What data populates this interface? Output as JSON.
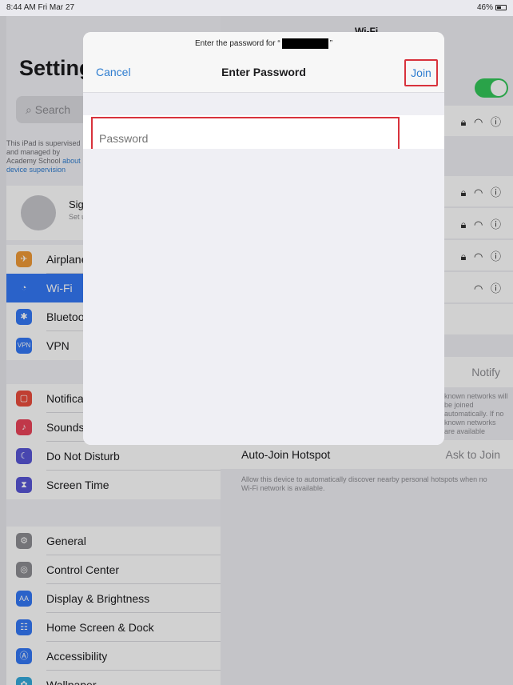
{
  "status": {
    "time": "8:44 AM  Fri Mar 27",
    "battery": "46%"
  },
  "sidebar": {
    "title": "Settings",
    "search_placeholder": "Search",
    "note": "This iPad is supervised and managed by Academy School",
    "note_link": "about device supervision",
    "account_name": "Sign in to your iPad",
    "account_sub": "Set up iCloud",
    "items": [
      {
        "label": "Airplane Mode",
        "icon": "airplane-icon",
        "color": "#f09a37"
      },
      {
        "label": "Wi-Fi",
        "icon": "wifi-icon",
        "color": "#3478f6"
      },
      {
        "label": "Bluetooth",
        "icon": "bluetooth-icon",
        "color": "#3478f6"
      },
      {
        "label": "VPN",
        "icon": "vpn-icon",
        "color": "#3478f6"
      },
      {
        "label": "Notifications",
        "icon": "notifications-icon",
        "color": "#eb4d3d"
      },
      {
        "label": "Sounds",
        "icon": "sounds-icon",
        "color": "#eb445a"
      },
      {
        "label": "Do Not Disturb",
        "icon": "moon-icon",
        "color": "#5856d6"
      },
      {
        "label": "Screen Time",
        "icon": "hourglass-icon",
        "color": "#5856d6"
      },
      {
        "label": "General",
        "icon": "gear-icon",
        "color": "#8e8e93"
      },
      {
        "label": "Control Center",
        "icon": "toggles-icon",
        "color": "#8e8e93"
      },
      {
        "label": "Display & Brightness",
        "icon": "text-size-icon",
        "color": "#3478f6"
      },
      {
        "label": "Home Screen & Dock",
        "icon": "grid-icon",
        "color": "#3478f6"
      },
      {
        "label": "Accessibility",
        "icon": "accessibility-icon",
        "color": "#3478f6"
      },
      {
        "label": "Wallpaper",
        "icon": "wallpaper-icon",
        "color": "#35aadc"
      }
    ]
  },
  "right": {
    "title": "Wi-Fi",
    "ask_value": "Notify",
    "ask_note": "known networks will be joined automatically. If no known networks are available",
    "hotspot_label": "Auto-Join Hotspot",
    "hotspot_value": "Ask to Join",
    "hotspot_desc": "Allow this device to automatically discover nearby personal hotspots when no Wi-Fi network is available."
  },
  "modal": {
    "prompt_prefix": "Enter the password for “",
    "prompt_suffix": "”",
    "cancel": "Cancel",
    "title": "Enter Password",
    "join": "Join",
    "password_placeholder": "Password"
  }
}
